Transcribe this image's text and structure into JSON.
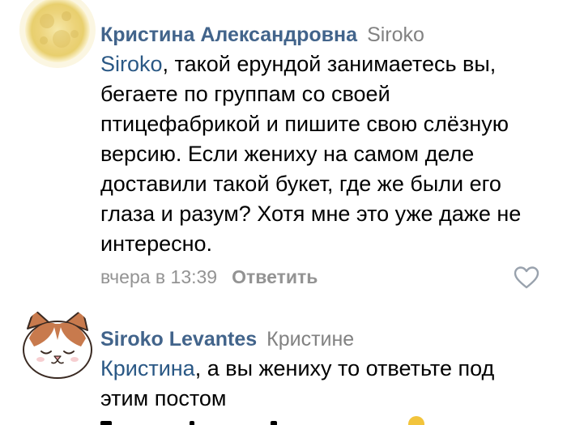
{
  "comments": [
    {
      "author": "Кристина Александровна",
      "reply_to": "Siroko",
      "mention": "Siroko",
      "text": ", такой ерундой занимаетесь вы, бегаете по группам со своей птицефабрикой и пишите свою слёзную версию. Если жениху на самом деле доставили такой букет, где же были его глаза и разум? Хотя мне это уже даже не интересно.",
      "time": "вчера в 13:39",
      "reply_label": "Ответить",
      "avatar_icon": "moon-icon"
    },
    {
      "author": "Siroko Levantes",
      "reply_to": "Кристине",
      "mention": "Кристина",
      "text": ", а вы жениху то ответьте под этим постом",
      "avatar_icon": "cat-face-icon"
    }
  ],
  "colors": {
    "author": "#42648b",
    "mention": "#2a5885",
    "meta": "#939393",
    "reply_to": "#828282"
  }
}
